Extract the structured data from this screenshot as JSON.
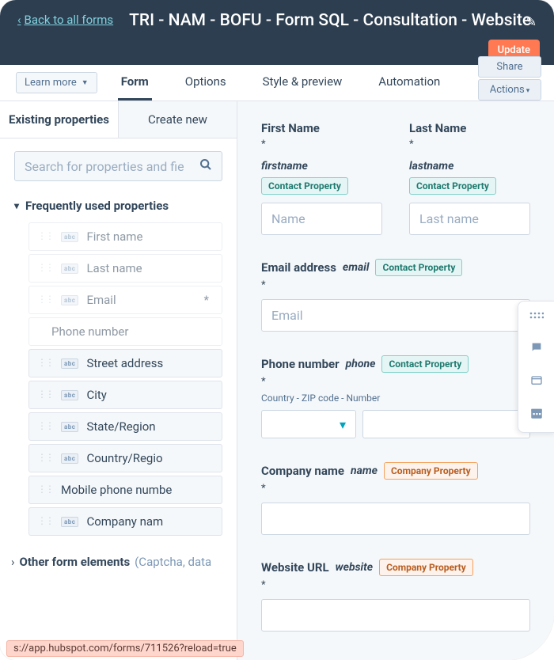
{
  "header": {
    "back_label": "Back to all forms",
    "title": "TRI - NAM - BOFU - Form SQL - Consultation - Website",
    "update_label": "Update"
  },
  "toolbar": {
    "learn_more": "Learn more",
    "tabs": [
      "Form",
      "Options",
      "Style & preview",
      "Automation"
    ],
    "share": "Share",
    "actions": "Actions"
  },
  "left": {
    "tab_existing": "Existing properties",
    "tab_create": "Create new",
    "search_placeholder": "Search for properties and fie",
    "section_title": "Frequently used properties",
    "items": {
      "first_name": "First name",
      "last_name": "Last name",
      "email": "Email",
      "phone": "Phone number",
      "street": "Street address",
      "city": "City",
      "state": "State/Region",
      "country": "Country/Regio",
      "mobile": "Mobile phone numbe",
      "company": "Company nam"
    },
    "other_label": "Other form elements",
    "other_hint": "(Captcha, data"
  },
  "canvas": {
    "first_name": {
      "label": "First Name",
      "api": "firstname",
      "badge": "Contact Property",
      "placeholder": "Name"
    },
    "last_name": {
      "label": "Last Name",
      "api": "lastname",
      "badge": "Contact Property",
      "placeholder": "Last name"
    },
    "email": {
      "label": "Email address",
      "api": "email",
      "badge": "Contact Property",
      "placeholder": "Email"
    },
    "phone": {
      "label": "Phone number",
      "api": "phone",
      "badge": "Contact Property",
      "hint": "Country - ZIP code - Number"
    },
    "company": {
      "label": "Company name",
      "api": "name",
      "badge": "Company Property"
    },
    "website": {
      "label": "Website URL",
      "api": "website",
      "badge": "Company Property"
    },
    "req": "*"
  },
  "url_preview": "s://app.hubspot.com/forms/711526?reload=true"
}
